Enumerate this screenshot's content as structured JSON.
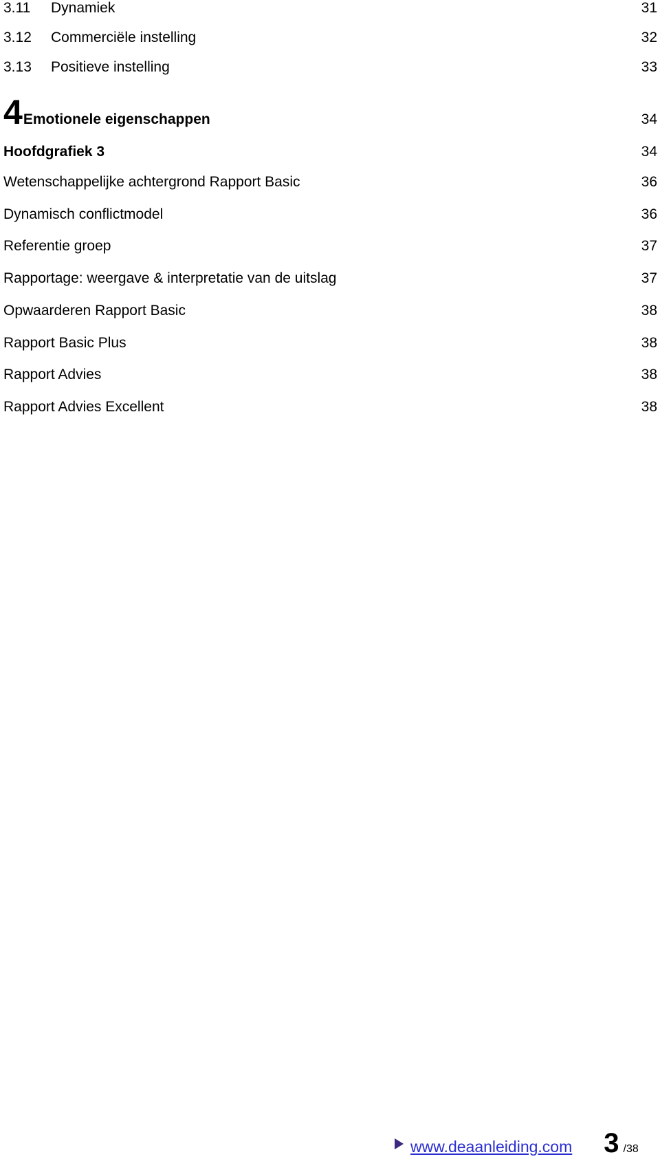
{
  "toc": {
    "sub_entries": [
      {
        "number": "3.11",
        "title": "Dynamiek",
        "page": "31"
      },
      {
        "number": "3.12",
        "title": "Commerciële instelling",
        "page": "32"
      },
      {
        "number": "3.13",
        "title": "Positieve instelling",
        "page": "33"
      }
    ],
    "chapter": {
      "number": "4",
      "title": "Emotionele eigenschappen",
      "page": "34"
    },
    "section": {
      "title": "Hoofdgrafiek 3",
      "page": "34"
    },
    "entries": [
      {
        "title": "Wetenschappelijke achtergrond Rapport Basic",
        "page": "36"
      },
      {
        "title": "Dynamisch conflictmodel",
        "page": "36"
      },
      {
        "title": "Referentie groep",
        "page": "37"
      },
      {
        "title": "Rapportage: weergave & interpretatie van de uitslag",
        "page": "37"
      },
      {
        "title": "Opwaarderen Rapport Basic",
        "page": "38"
      },
      {
        "title": "Rapport Basic Plus",
        "page": "38"
      },
      {
        "title": "Rapport Advies",
        "page": "38"
      },
      {
        "title": "Rapport Advies Excellent",
        "page": "38"
      }
    ]
  },
  "footer": {
    "icon": "triangle-right-icon",
    "link": "www.deaanleiding.com",
    "page_number": "3",
    "page_total": "/38",
    "link_color": "#2a2ed0"
  }
}
